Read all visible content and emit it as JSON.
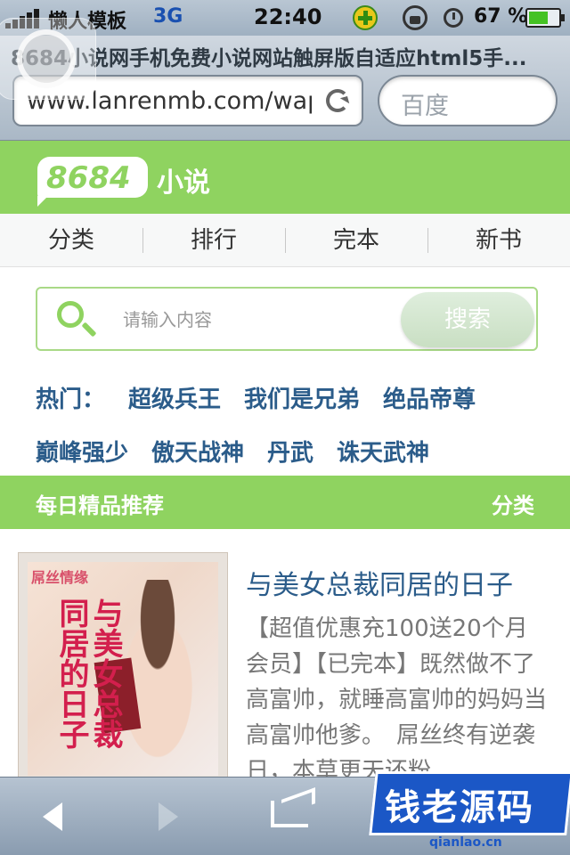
{
  "status_bar": {
    "carrier": "懒人模板",
    "network": "3G",
    "time": "22:40",
    "battery": "67 %",
    "battery_level_percent": 67
  },
  "browser": {
    "page_title": "8684小说网手机免费小说网站触屏版自适应html5手...",
    "url": "www.lanrenmb.com/wap",
    "search_placeholder": "百度"
  },
  "site": {
    "logo_number": "8684",
    "logo_text": "小说",
    "accent_color": "#8fd360"
  },
  "nav": {
    "items": [
      {
        "label": "分类"
      },
      {
        "label": "排行"
      },
      {
        "label": "完本"
      },
      {
        "label": "新书"
      }
    ]
  },
  "search": {
    "placeholder": "请输入内容",
    "button": "搜索"
  },
  "hot": {
    "label": "热门：",
    "keywords": [
      "超级兵王",
      "我们是兄弟",
      "绝品帝尊",
      "巅峰强少",
      "傲天战神",
      "丹武",
      "诛天武神"
    ]
  },
  "recommend": {
    "title": "每日精品推荐",
    "more": "分类"
  },
  "book": {
    "title": "与美女总裁同居的日子",
    "description": "【超值优惠充100送20个月会员】【已完本】既然做不了高富帅，就睡高富帅的妈妈当高富帅他爹。　屌丝终有逆袭日，本草更天还粉",
    "cover_tag": "屌丝情缘",
    "cover_title": "与美女总裁同居的日子"
  },
  "watermark": {
    "text": "钱老源码",
    "url": "qianlao.cn"
  }
}
